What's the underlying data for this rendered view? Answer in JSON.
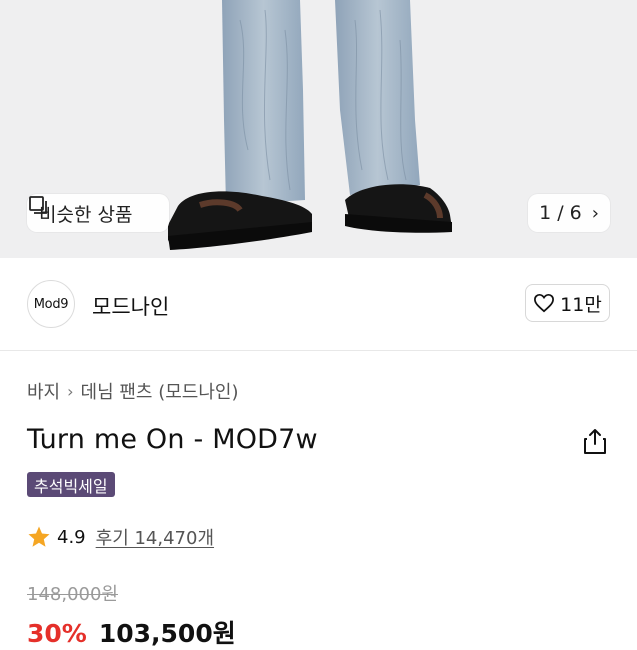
{
  "hero": {
    "similar_label": "비슷한 상품",
    "pager": "1 / 6"
  },
  "brand": {
    "logo_text": "Mod9",
    "name": "모드나인",
    "likes": "11만"
  },
  "breadcrumb": [
    "바지",
    "데님 팬츠 (모드나인)"
  ],
  "product": {
    "title": "Turn me On - MOD7w",
    "tag": "추석빅세일",
    "rating": "4.9",
    "reviews": "후기 14,470개",
    "original_price": "148,000원",
    "discount": "30%",
    "sale_price": "103,500원"
  },
  "colors": {
    "tag_bg": "#5b4a76",
    "discount": "#e5302a",
    "star": "#f5a623"
  },
  "icons": [
    "similar-items-icon",
    "chevron-right-icon",
    "heart-icon",
    "share-icon",
    "star-icon"
  ]
}
